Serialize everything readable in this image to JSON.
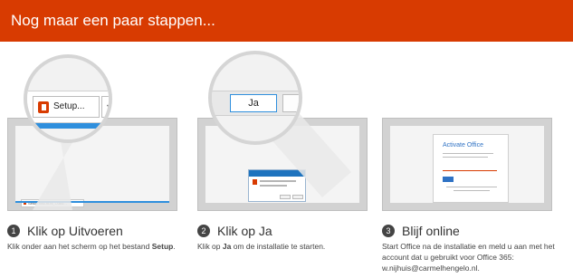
{
  "header": {
    "title": "Nog maar een paar stappen..."
  },
  "steps": [
    {
      "number": "1",
      "title": "Klik op Uitvoeren",
      "desc_prefix": "Klik onder aan het scherm op het bestand ",
      "desc_bold": "Setup",
      "desc_suffix": ".",
      "magnifier": {
        "button_label": "Setup...",
        "dropdown_glyph": "▾"
      },
      "taskbar": {
        "item_label": "Setup.X86.nl-nl_O365..."
      }
    },
    {
      "number": "2",
      "title": "Klik op Ja",
      "desc_prefix": "Klik op ",
      "desc_bold": "Ja",
      "desc_suffix": " om de installatie te starten.",
      "magnifier": {
        "button_label": "Ja"
      }
    },
    {
      "number": "3",
      "title": "Blijf online",
      "desc": "Start Office na de installatie en meld u aan met het account dat u gebruikt voor Office 365: w.nijhuis@carmelhengelo.nl.",
      "dialog": {
        "title": "Activate Office"
      }
    }
  ],
  "colors": {
    "accent": "#d83b01",
    "blue": "#2f8fdd",
    "screen": "#d2d2d2"
  }
}
